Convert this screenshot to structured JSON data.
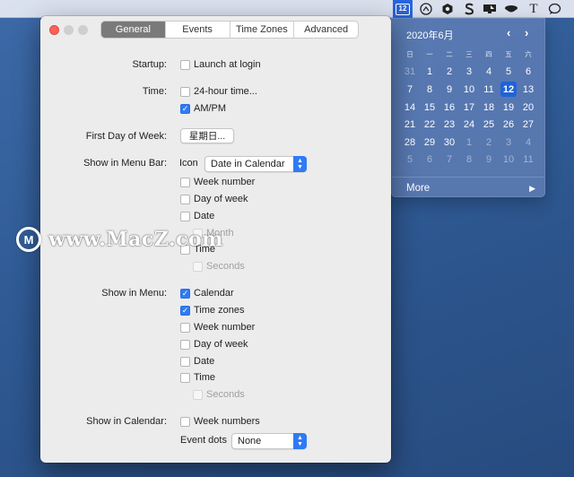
{
  "menubar": {
    "calendar_day": "12",
    "text_icon": "T"
  },
  "calendar": {
    "title": "2020年6月",
    "prev": "‹",
    "next": "›",
    "weekdays": [
      "日",
      "一",
      "二",
      "三",
      "四",
      "五",
      "六"
    ],
    "days": [
      {
        "d": "31",
        "dim": true
      },
      {
        "d": "1"
      },
      {
        "d": "2"
      },
      {
        "d": "3"
      },
      {
        "d": "4"
      },
      {
        "d": "5"
      },
      {
        "d": "6"
      },
      {
        "d": "7"
      },
      {
        "d": "8"
      },
      {
        "d": "9"
      },
      {
        "d": "10"
      },
      {
        "d": "11"
      },
      {
        "d": "12",
        "today": true
      },
      {
        "d": "13"
      },
      {
        "d": "14"
      },
      {
        "d": "15"
      },
      {
        "d": "16"
      },
      {
        "d": "17"
      },
      {
        "d": "18"
      },
      {
        "d": "19"
      },
      {
        "d": "20"
      },
      {
        "d": "21"
      },
      {
        "d": "22"
      },
      {
        "d": "23"
      },
      {
        "d": "24"
      },
      {
        "d": "25"
      },
      {
        "d": "26"
      },
      {
        "d": "27"
      },
      {
        "d": "28"
      },
      {
        "d": "29"
      },
      {
        "d": "30"
      },
      {
        "d": "1",
        "dim": true
      },
      {
        "d": "2",
        "dim": true
      },
      {
        "d": "3",
        "dim": true
      },
      {
        "d": "4",
        "dim": true
      },
      {
        "d": "5",
        "dim": true
      },
      {
        "d": "6",
        "dim": true
      },
      {
        "d": "7",
        "dim": true
      },
      {
        "d": "8",
        "dim": true
      },
      {
        "d": "9",
        "dim": true
      },
      {
        "d": "10",
        "dim": true
      },
      {
        "d": "11",
        "dim": true
      }
    ],
    "more_label": "More",
    "more_arrow": "▶"
  },
  "tabs": [
    {
      "label": "General",
      "active": true
    },
    {
      "label": "Events",
      "active": false
    },
    {
      "label": "Time Zones",
      "active": false
    },
    {
      "label": "Advanced",
      "active": false
    }
  ],
  "general": {
    "startup_label": "Startup:",
    "launch_at_login": {
      "label": "Launch at login",
      "checked": false
    },
    "time_label": "Time:",
    "hour24": {
      "label": "24-hour time...",
      "checked": false
    },
    "ampm": {
      "label": "AM/PM",
      "checked": true
    },
    "first_day_label": "First Day of Week:",
    "first_day_value": "星期日...",
    "menubar_label": "Show in Menu Bar:",
    "icon_label": "Icon",
    "icon_value": "Date in Calendar",
    "mb_week_number": {
      "label": "Week number",
      "checked": false
    },
    "mb_day_of_week": {
      "label": "Day of week",
      "checked": false
    },
    "mb_date": {
      "label": "Date",
      "checked": false
    },
    "mb_month": {
      "label": "Month",
      "checked": false,
      "disabled": true
    },
    "mb_time": {
      "label": "Time",
      "checked": false
    },
    "mb_seconds": {
      "label": "Seconds",
      "checked": false,
      "disabled": true
    },
    "menu_label": "Show in Menu:",
    "m_calendar": {
      "label": "Calendar",
      "checked": true
    },
    "m_time_zones": {
      "label": "Time zones",
      "checked": true
    },
    "m_week_number": {
      "label": "Week number",
      "checked": false
    },
    "m_day_of_week": {
      "label": "Day of week",
      "checked": false
    },
    "m_date": {
      "label": "Date",
      "checked": false
    },
    "m_time": {
      "label": "Time",
      "checked": false
    },
    "m_seconds": {
      "label": "Seconds",
      "checked": false,
      "disabled": true
    },
    "calendar_label": "Show in Calendar:",
    "c_week_numbers": {
      "label": "Week numbers",
      "checked": false
    },
    "event_dots_label": "Event dots",
    "event_dots_value": "None"
  },
  "watermark": {
    "logo_letter": "M",
    "text": "www.MacZ.com"
  },
  "colors": {
    "accent": "#2f7bf5",
    "close": "#fc605b",
    "today": "#1f63d8"
  }
}
